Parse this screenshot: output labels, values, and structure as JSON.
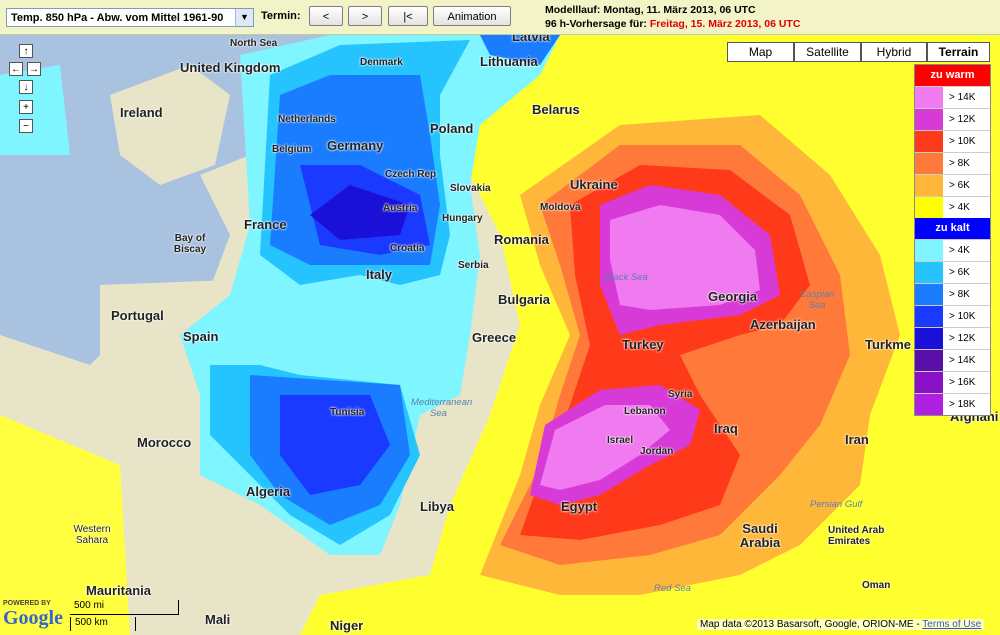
{
  "toolbar": {
    "parameter": "Temp. 850 hPa - Abw. vom Mittel 1961-90",
    "termin_label": "Termin:",
    "prev_label": "<",
    "next_label": ">",
    "first_label": "|<",
    "animation_label": "Animation"
  },
  "info": {
    "modelrun_label": "Modelllauf:",
    "modelrun_value": "Montag, 11. März 2013, 06 UTC",
    "forecast_label": "96 h-Vorhersage für:",
    "forecast_value": "Freitag, 15. März 2013, 06 UTC"
  },
  "map_types": [
    "Map",
    "Satellite",
    "Hybrid",
    "Terrain"
  ],
  "active_map_type": "Terrain",
  "legend": {
    "warm_title": "zu warm",
    "cold_title": "zu kalt",
    "warm": [
      {
        "label": "> 14K",
        "color": "#f07af0"
      },
      {
        "label": "> 12K",
        "color": "#d83ad8"
      },
      {
        "label": "> 10K",
        "color": "#ff3a1a"
      },
      {
        "label": "> 8K",
        "color": "#ff7a3a"
      },
      {
        "label": "> 6K",
        "color": "#ffb73a"
      },
      {
        "label": "> 4K",
        "color": "#ffff00"
      }
    ],
    "cold": [
      {
        "label": "> 4K",
        "color": "#7ff5ff"
      },
      {
        "label": "> 6K",
        "color": "#26c4ff"
      },
      {
        "label": "> 8K",
        "color": "#1a7cff"
      },
      {
        "label": "> 10K",
        "color": "#1a3aff"
      },
      {
        "label": "> 12K",
        "color": "#1a10d8"
      },
      {
        "label": "> 14K",
        "color": "#5a10a8"
      },
      {
        "label": "> 16K",
        "color": "#8a10c8"
      },
      {
        "label": "> 18K",
        "color": "#b020e0"
      }
    ]
  },
  "places": {
    "north_sea": "North Sea",
    "latvia": "Latvia",
    "uk": "United Kingdom",
    "denmark": "Denmark",
    "lithuania": "Lithuania",
    "ireland": "Ireland",
    "netherlands": "Netherlands",
    "belarus": "Belarus",
    "germany": "Germany",
    "poland": "Poland",
    "belgium": "Belgium",
    "czech": "Czech Rep",
    "slovakia": "Slovakia",
    "ukraine": "Ukraine",
    "austria": "Austria",
    "hungary": "Hungary",
    "moldova": "Moldova",
    "france": "France",
    "bay_of_biscay": "Bay of Biscay",
    "croatia": "Croatia",
    "romania": "Romania",
    "serbia": "Serbia",
    "italy": "Italy",
    "black_sea": "Black Sea",
    "georgia": "Georgia",
    "caspian_sea": "Caspian Sea",
    "bulgaria": "Bulgaria",
    "portugal": "Portugal",
    "spain": "Spain",
    "azerbaijan": "Azerbaijan",
    "greece": "Greece",
    "turkey": "Turkey",
    "turkmen": "Turkme",
    "mediterranean": "Mediterranean Sea",
    "tunisia": "Tunisia",
    "syria": "Syria",
    "lebanon": "Lebanon",
    "afghan": "Afghani",
    "morocco": "Morocco",
    "iraq": "Iraq",
    "israel": "Israel",
    "jordan": "Jordan",
    "iran": "Iran",
    "algeria": "Algeria",
    "libya": "Libya",
    "egypt": "Egypt",
    "persian_gulf": "Persian Gulf",
    "western_sahara": "Western Sahara",
    "saudi_arabia": "Saudi Arabia",
    "uae": "United Arab Emirates",
    "oman": "Oman",
    "mauritania": "Mauritania",
    "red_sea": "Red Sea",
    "mali": "Mali",
    "niger": "Niger"
  },
  "scale": {
    "mi": "500 mi",
    "km": "500 km"
  },
  "attribution": {
    "text": "Map data ©2013 Basarsoft, Google, ORION-ME -",
    "terms": "Terms of Use"
  },
  "google": {
    "powered": "POWERED BY",
    "logo": "Google"
  }
}
